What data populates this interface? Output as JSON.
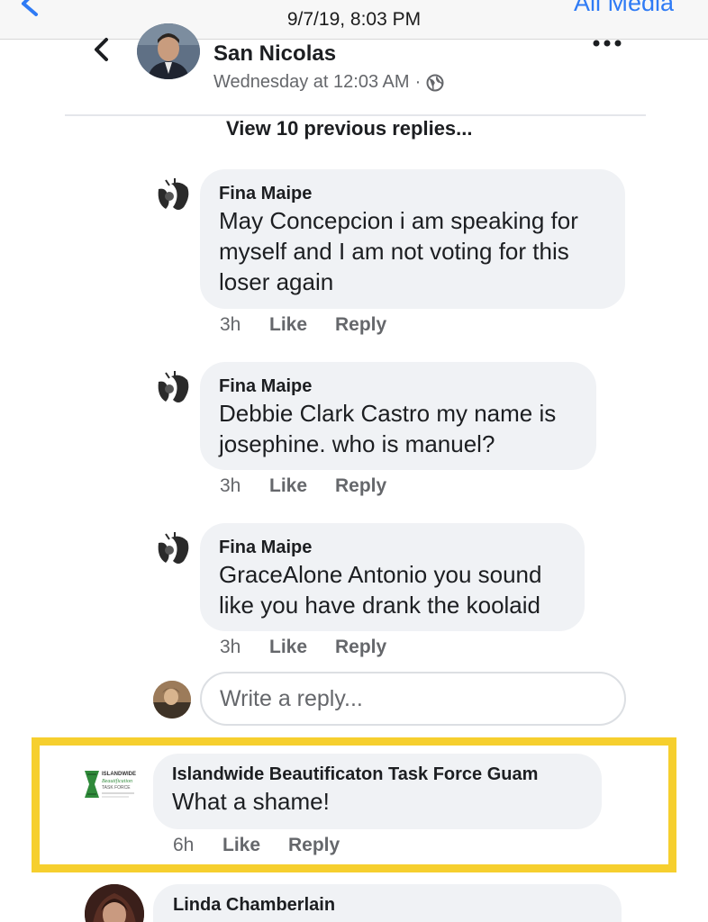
{
  "topbar": {
    "timestamp": "9/7/19, 8:03 PM",
    "right_link": "All Media"
  },
  "post": {
    "author": "San Nicolas",
    "time": "Wednesday at 12:03 AM",
    "separator": "·",
    "audience_icon": "globe-icon",
    "more_icon": "more-dots-icon"
  },
  "thread": {
    "view_previous": "View 10 previous replies...",
    "replies": [
      {
        "name": "Fina Maipe",
        "lines": [
          "May Concepcion i am speaking for",
          "myself and I am not voting for this",
          "loser again"
        ],
        "age": "3h",
        "like": "Like",
        "reply": "Reply"
      },
      {
        "name": "Fina Maipe",
        "lines": [
          "Debbie Clark Castro my name is",
          "josephine. who is manuel?"
        ],
        "age": "3h",
        "like": "Like",
        "reply": "Reply"
      },
      {
        "name": "Fina Maipe",
        "lines": [
          "GraceAlone Antonio you sound",
          "like you have drank the koolaid"
        ],
        "age": "3h",
        "like": "Like",
        "reply": "Reply"
      }
    ],
    "write_placeholder": "Write a reply..."
  },
  "highlighted_comment": {
    "name": "Islandwide Beautificaton Task Force Guam",
    "text": "What a shame!",
    "age": "6h",
    "like": "Like",
    "reply": "Reply",
    "logo_text": "ISLANDWIDE Beautification TASK FORCE",
    "highlight_color": "#f6cf2e"
  },
  "next_comment": {
    "name": "Linda Chamberlain"
  },
  "colors": {
    "ios_blue": "#2f7bf5",
    "bubble_bg": "#f0f2f5",
    "secondary_text": "#65676b"
  }
}
